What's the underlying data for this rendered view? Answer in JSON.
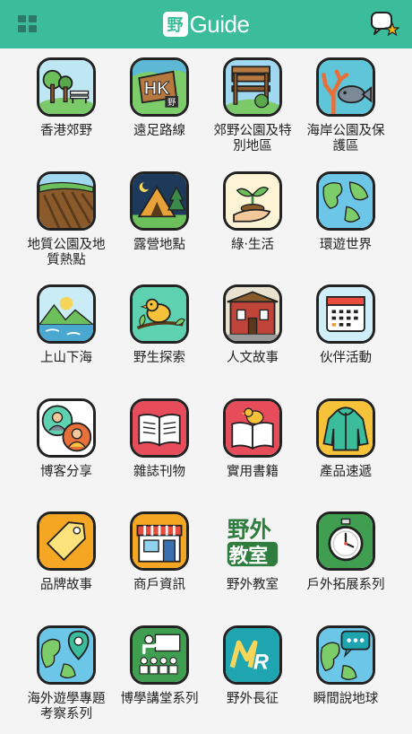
{
  "header": {
    "logo_badge": "野",
    "logo_text": "Guide"
  },
  "colors": {
    "brand": "#3bbc9b",
    "background": "#f4f4f4"
  },
  "grid": {
    "items": [
      {
        "label": "香港郊野",
        "icon": "park-bench-icon"
      },
      {
        "label": "遠足路線",
        "icon": "hk-hiking-sign-icon"
      },
      {
        "label": "郊野公園及特別地區",
        "icon": "wooden-bench-icon"
      },
      {
        "label": "海岸公園及保護區",
        "icon": "fish-coral-icon"
      },
      {
        "label": "地質公園及地質熱點",
        "icon": "rock-strata-icon"
      },
      {
        "label": "露營地點",
        "icon": "tent-icon"
      },
      {
        "label": "綠‧生活",
        "icon": "sprout-hand-icon"
      },
      {
        "label": "環遊世界",
        "icon": "globe-icon"
      },
      {
        "label": "上山下海",
        "icon": "mountain-lake-icon"
      },
      {
        "label": "野生探索",
        "icon": "bird-branch-icon"
      },
      {
        "label": "人文故事",
        "icon": "old-building-icon"
      },
      {
        "label": "伙伴活動",
        "icon": "calendar-icon"
      },
      {
        "label": "博客分享",
        "icon": "bloggers-icon"
      },
      {
        "label": "雜誌刊物",
        "icon": "open-book-icon"
      },
      {
        "label": "實用書籍",
        "icon": "bird-book-icon"
      },
      {
        "label": "產品速遞",
        "icon": "jacket-icon"
      },
      {
        "label": "品牌故事",
        "icon": "tag-icon"
      },
      {
        "label": "商戶資訊",
        "icon": "shop-icon"
      },
      {
        "label": "野外教室",
        "icon": "outdoor-classroom-icon"
      },
      {
        "label": "戶外拓展系列",
        "icon": "stopwatch-icon"
      },
      {
        "label": "海外遊學專題考察系列",
        "icon": "globe-pin-icon"
      },
      {
        "label": "博學講堂系列",
        "icon": "lecture-icon"
      },
      {
        "label": "野外長征",
        "icon": "mr-logo-icon"
      },
      {
        "label": "瞬間說地球",
        "icon": "globe-chat-icon"
      }
    ]
  }
}
